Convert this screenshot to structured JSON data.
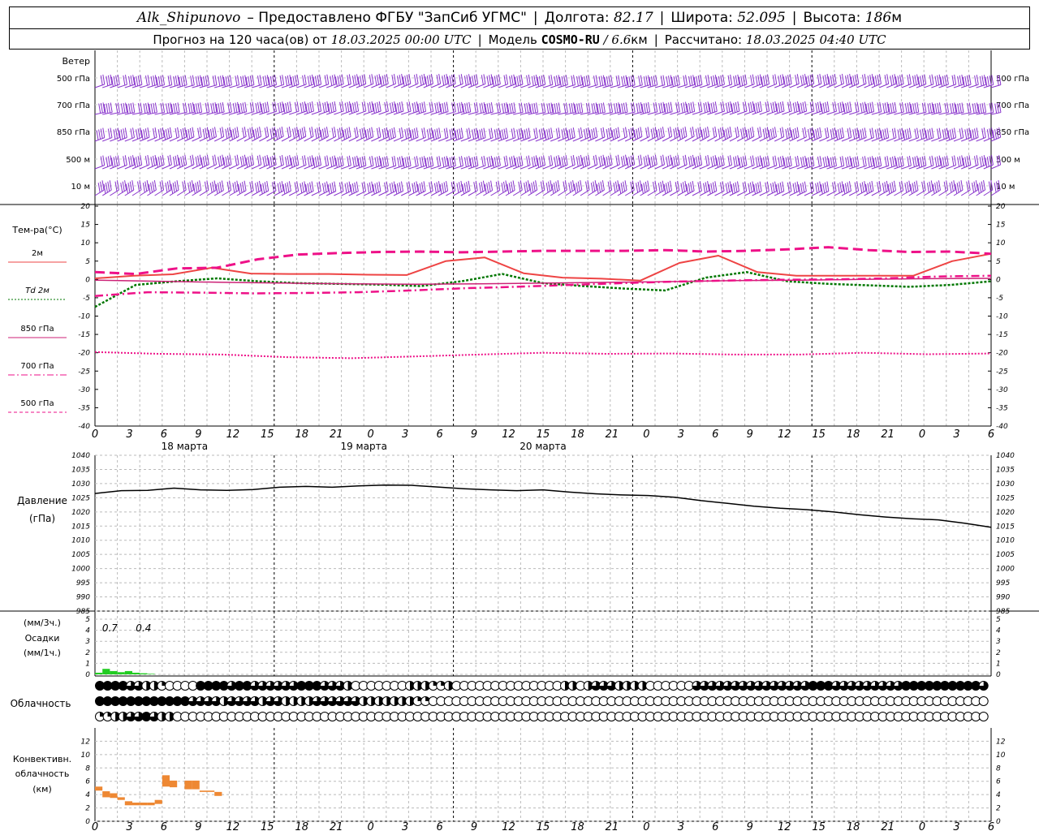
{
  "header": {
    "station": "Alk_Shipunovo",
    "provided_by": "– Предоставлено ФГБУ \"ЗапСиб УГМС\"",
    "lon_label": "Долгота:",
    "lon_value": "82.17",
    "lat_label": "Широта:",
    "lat_value": "52.095",
    "alt_label": "Высота:",
    "alt_value": "186",
    "alt_unit": "м",
    "forecast_label": "Прогноз на 120 часа(ов) от",
    "forecast_start": "18.03.2025 00:00 UTC",
    "model_label": "Модель",
    "model_name": "COSMO-RU",
    "model_res": "/ 6.6",
    "model_res_unit": "км",
    "computed_label": "Рассчитано:",
    "computed_time": "18.03.2025 04:40 UTC"
  },
  "chart_data": [
    {
      "type": "wind_barbs",
      "title": "Ветер",
      "levels": [
        "500 гПа",
        "700 гПа",
        "850 гПа",
        "500 м",
        "10  м"
      ]
    },
    {
      "type": "line",
      "ylabel": "Тем-ра(°C)",
      "ylim": [
        -40,
        20
      ],
      "yticks": [
        20,
        15,
        10,
        5,
        0,
        -5,
        -10,
        -15,
        -20,
        -25,
        -30,
        -35,
        -40
      ],
      "x_hours": [
        0,
        6,
        12,
        18,
        24,
        30,
        36,
        42,
        48,
        54,
        60,
        66,
        72,
        78,
        84,
        90,
        96,
        102,
        108,
        114,
        120
      ],
      "series": [
        {
          "name": "2м",
          "color": "#ee4444",
          "style": "solid",
          "values": [
            0.3,
            1,
            1.4,
            3.2,
            1.6,
            1.5,
            1.5,
            1.3,
            1.2,
            5,
            6,
            1.7,
            0.5,
            0.2,
            -0.3,
            4.5,
            6.5,
            2,
            1,
            1,
            1,
            1,
            5,
            7
          ]
        },
        {
          "name": "Td 2м",
          "color": "#007700",
          "style": "dotted",
          "values": [
            -7.5,
            -1.5,
            -0.5,
            0.3,
            -0.5,
            -1,
            -1.2,
            -1.4,
            -1.8,
            -0.5,
            1.5,
            -1,
            -1.8,
            -2.5,
            -3,
            0.5,
            2,
            -0.5,
            -1.2,
            -1.6,
            -2,
            -1.5,
            -0.5
          ]
        },
        {
          "name": "850 гПа",
          "color": "#cc2277",
          "style": "solid",
          "values": [
            -0.2,
            -0.5,
            -0.8,
            -1,
            -1.2,
            -1.3,
            -1.2,
            -1,
            -0.8,
            -0.6,
            -0.3,
            -0.2,
            0,
            0.2,
            0.3
          ]
        },
        {
          "name": "700 гПа",
          "color": "#ee1188",
          "style": "dashdot",
          "values": [
            -4.5,
            -3.5,
            -3.6,
            -3.8,
            -3.7,
            -3.5,
            -3,
            -2.4,
            -2,
            -1.5,
            -1,
            -0.6,
            -0.3,
            -0.1,
            0,
            0.3,
            0.8,
            1
          ]
        },
        {
          "name": "500 гПа",
          "color": "#ee1188",
          "style": "dashed",
          "values": [
            2,
            1.5,
            3,
            3.2,
            5.5,
            6.8,
            7.2,
            7.5,
            7.6,
            7.4,
            7.6,
            7.8,
            7.8,
            7.8,
            8,
            7.6,
            7.8,
            8.2,
            8.8,
            8,
            7.5,
            7.6,
            7
          ]
        }
      ],
      "upper_series_note": {
        "name": "500 гПа dotted",
        "values": [
          -19.8,
          -20.3,
          -20.5,
          -21.2,
          -21.5,
          -21,
          -20.5,
          -20,
          -20.3,
          -20.2,
          -20.5,
          -20.5,
          -20,
          -20.4,
          -20.2
        ]
      },
      "day_labels": [
        "18 марта",
        "19 марта",
        "20 марта"
      ],
      "hour_ticks": [
        "0",
        "3",
        "6",
        "9",
        "12",
        "15",
        "18",
        "21",
        "0",
        "3",
        "6",
        "9",
        "12",
        "15",
        "18",
        "21",
        "0",
        "3",
        "6",
        "9",
        "12",
        "15",
        "18",
        "21",
        "0",
        "3",
        "6"
      ]
    },
    {
      "type": "line",
      "ylabel": "Давление",
      "yunit": "(гПа)",
      "ylim": [
        985,
        1040
      ],
      "yticks": [
        1040,
        1035,
        1030,
        1025,
        1020,
        1015,
        1010,
        1005,
        1000,
        995,
        990,
        985
      ],
      "series": [
        {
          "name": "pressure",
          "color": "#000000",
          "values": [
            1026.5,
            1027.5,
            1027.6,
            1028.4,
            1027.8,
            1027.6,
            1027.9,
            1028.7,
            1029,
            1028.7,
            1029.2,
            1029.5,
            1029.4,
            1028.8,
            1028.2,
            1027.8,
            1027.5,
            1027.8,
            1027,
            1026.4,
            1026,
            1025.8,
            1025.2,
            1024,
            1023,
            1022,
            1021.3,
            1020.8,
            1020,
            1019,
            1018.2,
            1017.6,
            1017.2,
            1016,
            1014.6
          ]
        }
      ]
    },
    {
      "type": "bar",
      "ylabel_left_top": "(мм/3ч.)",
      "ylabel": "Осадки",
      "yunit": "(мм/1ч.)",
      "ylim": [
        0,
        5
      ],
      "yticks": [
        5,
        4,
        3,
        2,
        1,
        0
      ],
      "annotations": [
        "0.7",
        "0.4"
      ],
      "series": [
        {
          "name": "precip",
          "color": "#22cc22",
          "hours": [
            0,
            1,
            2,
            3,
            4,
            5,
            6,
            7
          ],
          "values": [
            0.15,
            0.5,
            0.3,
            0.2,
            0.3,
            0.15,
            0.1,
            0.05
          ]
        }
      ]
    },
    {
      "type": "cloud_circles",
      "ylabel": "Облачность",
      "rows": [
        [
          4,
          4,
          4,
          4,
          3,
          3,
          2,
          2,
          1,
          0,
          0,
          0,
          0,
          4,
          4,
          4,
          4,
          3,
          4,
          4,
          3,
          3,
          3,
          3,
          3,
          3,
          4,
          4,
          4,
          3,
          3,
          3,
          2,
          0,
          0,
          0,
          0,
          0,
          0,
          0,
          2,
          2,
          2,
          1,
          1,
          2,
          0,
          0,
          0,
          0,
          0,
          0,
          0,
          0,
          0,
          0,
          0,
          0,
          0,
          0,
          2,
          2,
          0,
          2,
          3,
          3,
          3,
          2,
          2,
          2,
          2,
          0,
          0,
          0,
          0,
          0,
          0,
          3,
          3,
          3,
          3,
          3,
          3,
          3,
          3,
          3,
          3,
          3,
          3,
          3,
          3,
          3,
          4,
          4,
          4,
          3,
          3,
          3,
          3,
          3,
          3,
          3,
          3,
          3,
          4,
          4,
          4,
          4,
          4,
          4,
          4,
          4,
          4,
          4,
          3
        ],
        [
          4,
          4,
          4,
          4,
          4,
          4,
          4,
          4,
          4,
          4,
          4,
          4,
          3,
          3,
          3,
          3,
          2,
          3,
          3,
          3,
          3,
          2,
          3,
          3,
          2,
          2,
          2,
          2,
          3,
          3,
          3,
          3,
          3,
          3,
          2,
          2,
          2,
          2,
          2,
          2,
          2,
          1,
          1,
          0,
          0,
          0,
          0,
          0,
          0,
          0,
          0,
          0,
          0,
          0,
          0,
          0,
          0,
          0,
          0,
          0,
          0,
          0,
          0,
          0,
          0,
          0,
          0,
          0,
          0,
          0,
          0,
          0,
          0,
          0,
          0,
          0,
          0,
          0,
          0,
          0,
          0,
          0,
          0,
          0,
          0,
          0,
          0,
          0,
          0,
          0,
          0,
          0,
          0,
          0,
          0,
          0,
          0,
          0,
          0,
          0,
          0,
          0,
          0,
          0,
          0,
          0,
          0,
          0,
          0,
          0,
          0,
          0,
          0,
          0,
          0,
          0
        ],
        [
          1,
          1,
          2,
          2,
          3,
          3,
          4,
          3,
          2,
          2,
          0,
          0,
          0,
          0,
          0,
          0,
          0,
          0,
          0,
          0,
          0,
          0,
          0,
          0,
          0,
          0,
          0,
          0,
          0,
          0,
          0,
          0,
          0,
          0,
          0,
          0,
          0,
          0,
          0,
          0,
          0,
          0,
          0,
          0,
          0,
          0,
          0,
          0,
          0,
          0,
          0,
          0,
          0,
          0,
          0,
          0,
          0,
          0,
          0,
          0,
          0,
          0,
          0,
          0,
          0,
          0,
          0,
          0,
          0,
          0,
          0,
          0,
          0,
          0,
          0,
          0,
          0,
          0,
          0,
          0,
          0,
          0,
          0,
          0,
          0,
          0,
          0,
          0,
          0,
          0,
          0,
          0,
          0,
          0,
          0,
          0,
          0,
          0,
          0,
          0,
          0,
          0,
          0,
          0,
          0,
          0,
          0,
          0,
          0,
          0,
          0,
          0,
          0,
          0,
          0,
          0
        ]
      ]
    },
    {
      "type": "bar",
      "ylabel": "Конвективн.",
      "ylabel2": "облачность",
      "yunit": "(км)",
      "ylim": [
        0,
        14
      ],
      "yticks": [
        12,
        10,
        8,
        6,
        4,
        2,
        0
      ],
      "series": [
        {
          "name": "convective",
          "color": "#ee8833",
          "hours": [
            0,
            1,
            2,
            3,
            4,
            5,
            6,
            7,
            8,
            9,
            10,
            12,
            13,
            14,
            15,
            16
          ],
          "values": [
            [
              4.6,
              5.2
            ],
            [
              3.6,
              4.5
            ],
            [
              3.5,
              4.2
            ],
            [
              3.2,
              3.6
            ],
            [
              2.4,
              3
            ],
            [
              2.4,
              2.8
            ],
            [
              2.4,
              2.8
            ],
            [
              2.4,
              2.8
            ],
            [
              2.6,
              3.2
            ],
            [
              5.2,
              6.9
            ],
            [
              5.1,
              6.1
            ],
            [
              4.8,
              6.1
            ],
            [
              4.8,
              6.1
            ],
            [
              4.4,
              4.6
            ],
            [
              4.4,
              4.6
            ],
            [
              3.8,
              4.4
            ]
          ]
        }
      ]
    }
  ]
}
